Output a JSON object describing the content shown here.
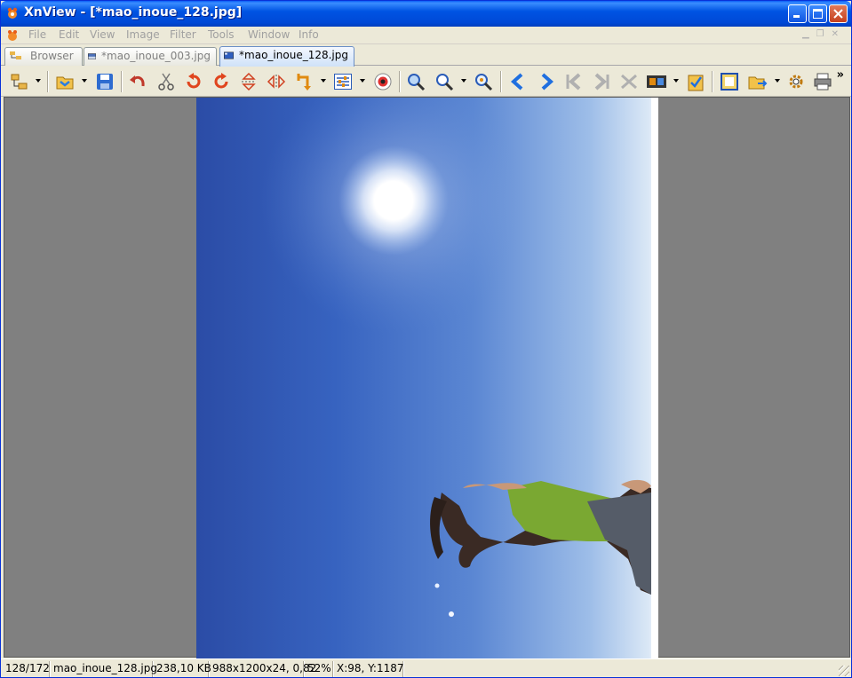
{
  "window": {
    "title": "XnView - [*mao_inoue_128.jpg]"
  },
  "menu": {
    "items": [
      "File",
      "Edit",
      "View",
      "Image",
      "Filter",
      "Tools",
      "Window",
      "Info"
    ]
  },
  "tabs": [
    {
      "label": "Browser",
      "active": false
    },
    {
      "label": "*mao_inoue_003.jpg",
      "active": false
    },
    {
      "label": "*mao_inoue_128.jpg",
      "active": true
    }
  ],
  "toolbar": {
    "overflow_label": "»"
  },
  "status": {
    "index": "128/172",
    "filename": "mao_inoue_128.jpg",
    "filesize": "238,10 KB",
    "dimensions": "988x1200x24, 0,82",
    "zoom": "52%",
    "coords": "X:98, Y:1187"
  },
  "colors": {
    "title_bar": "#0054e3",
    "viewer_bg": "#808080",
    "sky": "#3763c0",
    "top_bg": "#ece9d8"
  }
}
